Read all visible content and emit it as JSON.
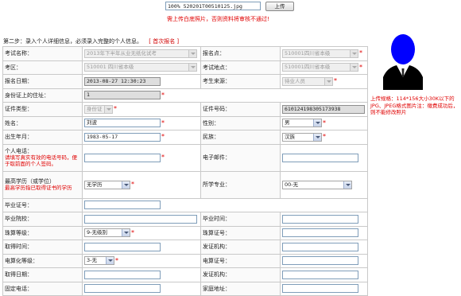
{
  "upload": {
    "file_value": "100%  520201T00510125.jpg",
    "button_label": "上传",
    "hint": "需上传白底照片，否则资料将审核不通过!"
  },
  "step": {
    "text": "第二步：录入个人详细信息，必须录入完整的个人信息。",
    "prev_link": "[ 首次报名 ]"
  },
  "form": {
    "exam_name": {
      "label": "考试名称：",
      "value": "2013年下半年从业无纸化试考"
    },
    "exam_point": {
      "label": "报名点：",
      "value": "510001四川省本级"
    },
    "exam_area": {
      "label": "考区：",
      "value": "510001 四川省本级"
    },
    "exam_site": {
      "label": "考试地点：",
      "value": "510001四川省本级"
    },
    "reg_date": {
      "label": "报名日期：",
      "value": "2013-08-27 12:30:23"
    },
    "source": {
      "label": "考生来源：",
      "value": "待业人员"
    },
    "household": {
      "label": "身份证上的住址：",
      "value": "1"
    },
    "id_type": {
      "label": "证件类型：",
      "value": "身份证"
    },
    "id_number": {
      "label": "证件号码：",
      "value": "610124198305173938"
    },
    "name": {
      "label": "姓名：",
      "value": "刘波"
    },
    "gender": {
      "label": "性别：",
      "value": "男"
    },
    "birth": {
      "label": "出生年月：",
      "value": "1983-05-17"
    },
    "ethnicity": {
      "label": "民族：",
      "value": "汉族"
    },
    "phone": {
      "label": "个人电话：",
      "note": "请填写真实有效的电话号码，便于取前面的个人签码。"
    },
    "email": {
      "label": "电子邮件："
    },
    "education": {
      "label": "最高学历（或学位）",
      "note": "最高学历指已取得证书的学历",
      "value": "无学历"
    },
    "major": {
      "label": "所学专业：",
      "value": "00-无"
    },
    "grad_cert": {
      "label": "毕业证号："
    },
    "grad_school": {
      "label": "毕业院校：",
      "right_label": "毕业时间："
    },
    "calc_level": {
      "label": "珠算等级：",
      "value": "9-无级别",
      "right_label": "珠算证号："
    },
    "obtain_time1": {
      "label": "取得时间：",
      "right_label": "发证机构："
    },
    "comp_level": {
      "label": "电算化等级：",
      "value": "3-无",
      "right_label": "电算证号："
    },
    "obtain_time2": {
      "label": "取得日期：",
      "right_label": "发证机构："
    },
    "landline": {
      "label": "固定电话：",
      "right_label": "家庭地址："
    }
  },
  "photo": {
    "note": "上传规格：114*156大小30K以下的JPG、JPEG格式图片注：缴费成功后，则不能修改照片"
  },
  "colors": {
    "accent_red": "#e00000",
    "avatar_blue": "#0000ff"
  }
}
